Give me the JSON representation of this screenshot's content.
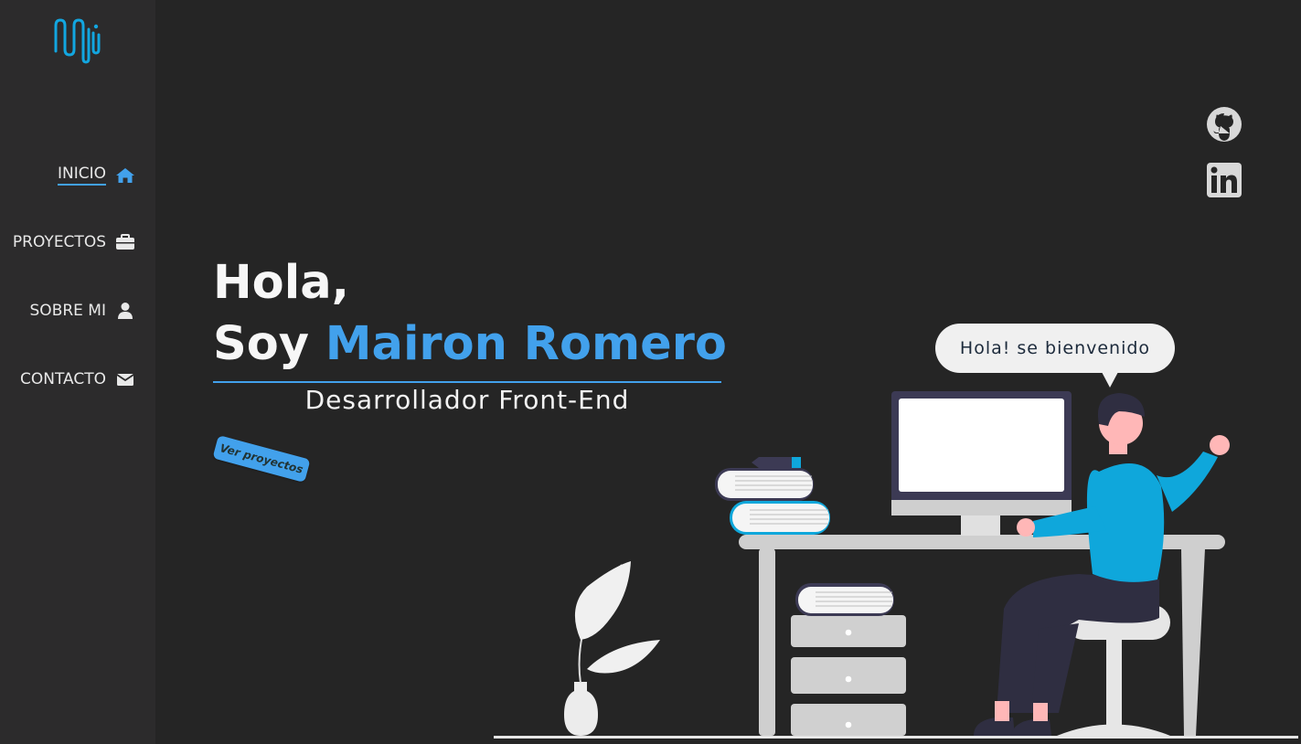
{
  "sidebar": {
    "logo_name": "mr-wave-logo",
    "items": [
      {
        "label": "INICIO",
        "icon": "home-icon",
        "active": true
      },
      {
        "label": "PROYECTOS",
        "icon": "briefcase-icon",
        "active": false
      },
      {
        "label": "SOBRE MI",
        "icon": "user-icon",
        "active": false
      },
      {
        "label": "CONTACTO",
        "icon": "envelope-icon",
        "active": false
      }
    ]
  },
  "social": [
    {
      "icon": "github-icon"
    },
    {
      "icon": "linkedin-icon"
    }
  ],
  "hero": {
    "greeting": "Hola,",
    "intro": "Soy ",
    "name": "Mairon Romero",
    "role": "Desarrollador Front-End",
    "cta_label": "Ver proyectos"
  },
  "speech_bubble": "Hola! se bienvenido",
  "colors": {
    "accent": "#42a1ec",
    "background": "#252525",
    "sidebar": "#2c2b2c",
    "person_shirt": "#0fa7db"
  }
}
